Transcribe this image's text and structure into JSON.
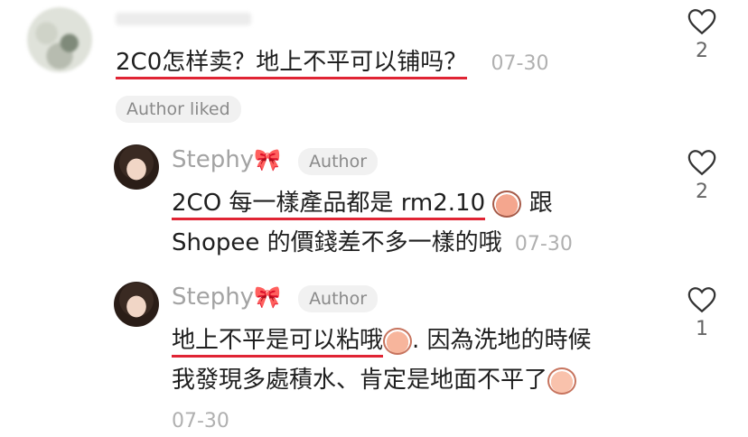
{
  "comments": [
    {
      "avatar": "blurred-user-avatar",
      "text": "2C0怎样卖？地上不平可以铺吗？",
      "date": "07-30",
      "badge": "Author liked",
      "likes": "2"
    }
  ],
  "replies": [
    {
      "username": "Stephy",
      "username_emoji": "🎀",
      "role": "Author",
      "line1_highlight": "2CO 每一樣產品都是 rm2.10",
      "line1_after": "跟",
      "line2": "Shopee 的價錢差不多一樣的哦",
      "date": "07-30",
      "likes": "2"
    },
    {
      "username": "Stephy",
      "username_emoji": "🎀",
      "role": "Author",
      "line1_highlight": "地上不平是可以粘哦",
      "line1_after": ". 因為洗地的時候",
      "line2": "我發現多處積水、肯定是地面不平了",
      "date": "07-30",
      "likes": "1"
    }
  ],
  "colors": {
    "underline": "#e02434",
    "meta": "#b0b0b0",
    "pill_bg": "#f1f1f1"
  }
}
